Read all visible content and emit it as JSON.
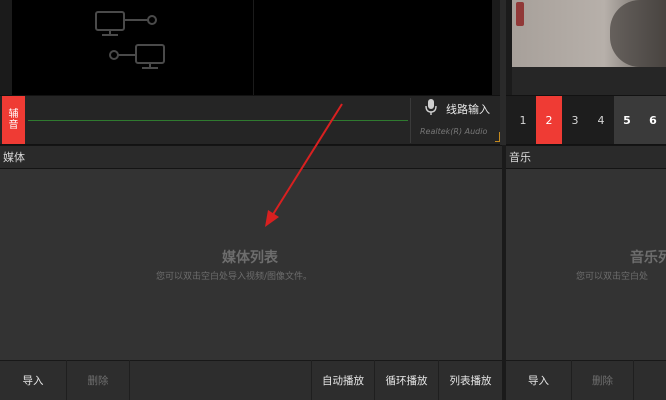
{
  "audio": {
    "aux_tab_label": "辅音",
    "input_label": "线路输入",
    "device_label": "Realtek(R) Audio"
  },
  "scenes": [
    "1",
    "2",
    "3",
    "4",
    "5",
    "6"
  ],
  "selected_scene": "2",
  "media_panel": {
    "title": "媒体",
    "empty_title": "媒体列表",
    "empty_hint": "您可以双击空白处导入视频/图像文件。",
    "import_label": "导入",
    "delete_label": "删除",
    "auto_play_label": "自动播放",
    "loop_play_label": "循环播放",
    "list_play_label": "列表播放"
  },
  "music_panel": {
    "title": "音乐",
    "empty_title": "音乐列",
    "empty_hint": "您可以双击空白处",
    "import_label": "导入",
    "delete_label": "删除"
  },
  "colors": {
    "accent": "#ef3b34",
    "annotation_arrow": "#d92020"
  },
  "icons": [
    "network-nodes-icon",
    "microphone-icon"
  ]
}
